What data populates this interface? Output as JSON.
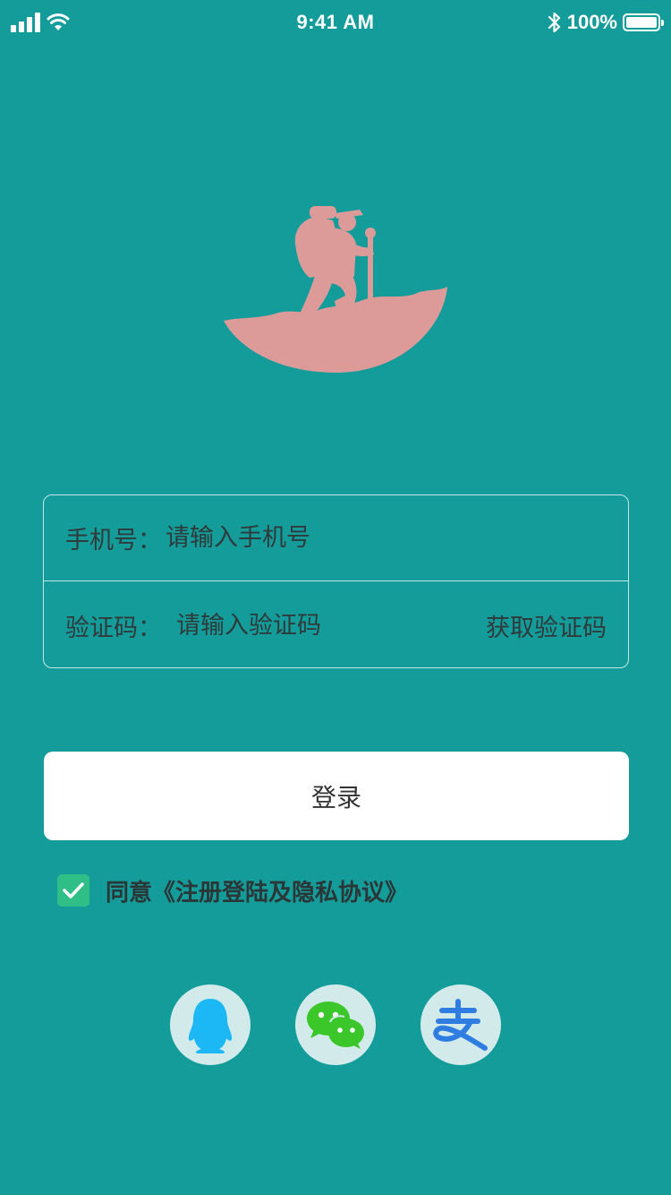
{
  "status_bar": {
    "time": "9:41 AM",
    "battery": "100%"
  },
  "form": {
    "phone_label": "手机号：",
    "phone_placeholder": "请输入手机号",
    "code_label": "验证码：",
    "code_placeholder": "请输入验证码",
    "get_code_label": "获取验证码"
  },
  "login": {
    "button_label": "登录"
  },
  "agreement": {
    "checked": true,
    "text": "同意《注册登陆及隐私协议》"
  },
  "social_login": [
    {
      "name": "qq-icon",
      "color": "#1bb8f5"
    },
    {
      "name": "wechat-icon",
      "color": "#3bc62a"
    },
    {
      "name": "alipay-icon",
      "color": "#2f7de1"
    }
  ],
  "colors": {
    "background": "#149c9b",
    "logo": "#dc9a99",
    "checkbox": "#2fbf86"
  }
}
